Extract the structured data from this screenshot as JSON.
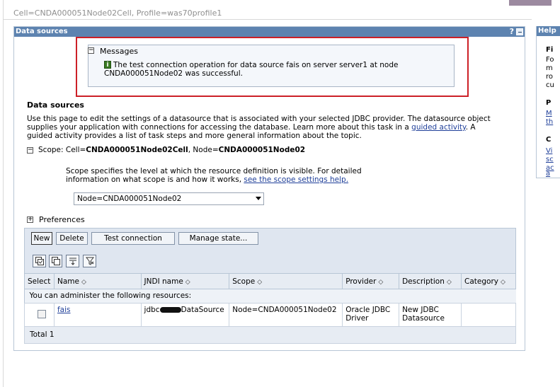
{
  "context": "Cell=CNDA000051Node02Cell, Profile=was70profile1",
  "portlet": {
    "title": "Data sources",
    "help": "?"
  },
  "messages": {
    "title": "Messages",
    "text": "The test connection operation for data source fais on server server1 at node CNDA000051Node02 was successful.",
    "icon": "info-icon"
  },
  "page": {
    "heading": "Data sources",
    "desc_1": "Use this page to edit the settings of a datasource that is associated with your selected JDBC provider. The datasource object supplies your application with connections for accessing the database. Learn more about this task in a ",
    "desc_link": "guided activity",
    "desc_2": ". A guided activity provides a list of task steps and more general information about the topic."
  },
  "scope": {
    "label": "Scope: Cell=",
    "cell": "CNDA000051Node02Cell",
    "node_label": ", Node=",
    "node": "CNDA000051Node02",
    "help_1": "Scope specifies the level at which the resource definition is visible. For detailed information on what scope is and how it works, ",
    "help_link": "see the scope settings help.",
    "selected": "Node=CNDA000051Node02"
  },
  "preferences": {
    "label": "Preferences"
  },
  "toolbar": {
    "new": "New",
    "delete": "Delete",
    "test": "Test connection",
    "manage": "Manage state..."
  },
  "table": {
    "headers": [
      "Select",
      "Name",
      "JNDI name",
      "Scope",
      "Provider",
      "Description",
      "Category"
    ],
    "admin_text": "You can administer the following resources:",
    "rows": [
      {
        "name": "fais",
        "jndi_prefix": "jdbc",
        "jndi_suffix": "DataSource",
        "scope": "Node=CNDA000051Node02",
        "provider": "Oracle JDBC Driver",
        "description": "New JDBC Datasource",
        "category": ""
      }
    ],
    "total": "Total 1"
  },
  "help_panel": {
    "title": "Help",
    "lines": [
      "Fi",
      "Fo",
      "m",
      "ro",
      "cu",
      "P",
      "M",
      "th",
      "C",
      "Vi",
      "sc",
      "ac",
      "a"
    ]
  }
}
